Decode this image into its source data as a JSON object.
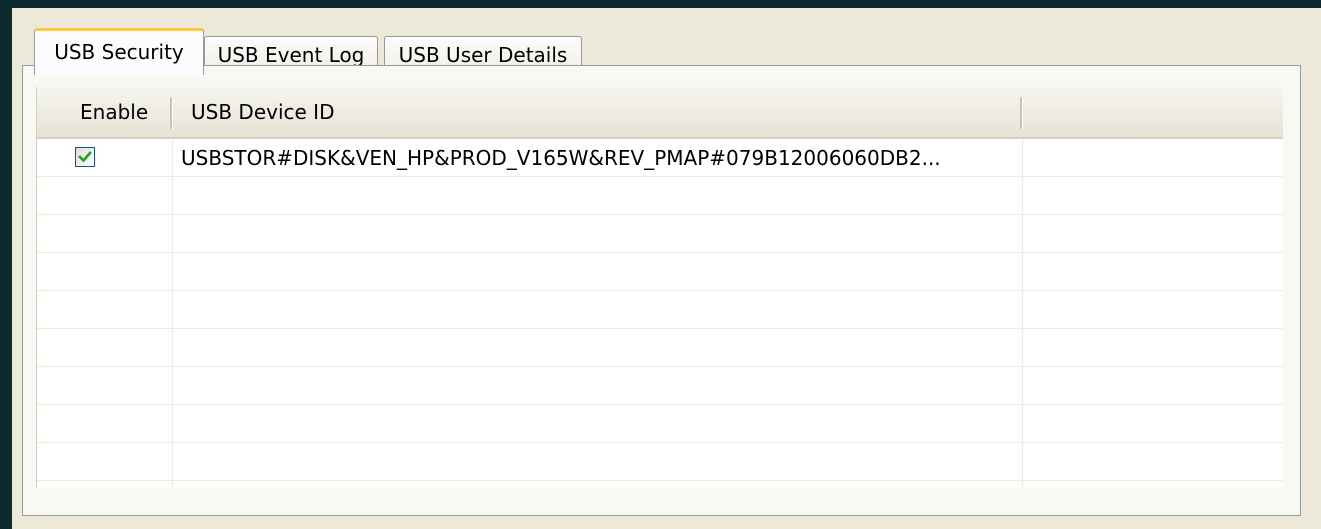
{
  "tabs": [
    {
      "label": "USB Security",
      "active": true
    },
    {
      "label": "USB Event Log",
      "active": false
    },
    {
      "label": "USB User Details",
      "active": false
    }
  ],
  "list": {
    "columns": [
      "Enable",
      "USB Device ID",
      ""
    ],
    "rows": [
      {
        "enabled": true,
        "device_id": "USBSTOR#DISK&VEN_HP&PROD_V165W&REV_PMAP#079B12006060DB2..."
      }
    ],
    "empty_rows": 8
  },
  "colors": {
    "background": "#0d2a2f",
    "panel": "#ece9d8",
    "tab_highlight": "#ffc83c",
    "checkmark": "#21a121"
  }
}
